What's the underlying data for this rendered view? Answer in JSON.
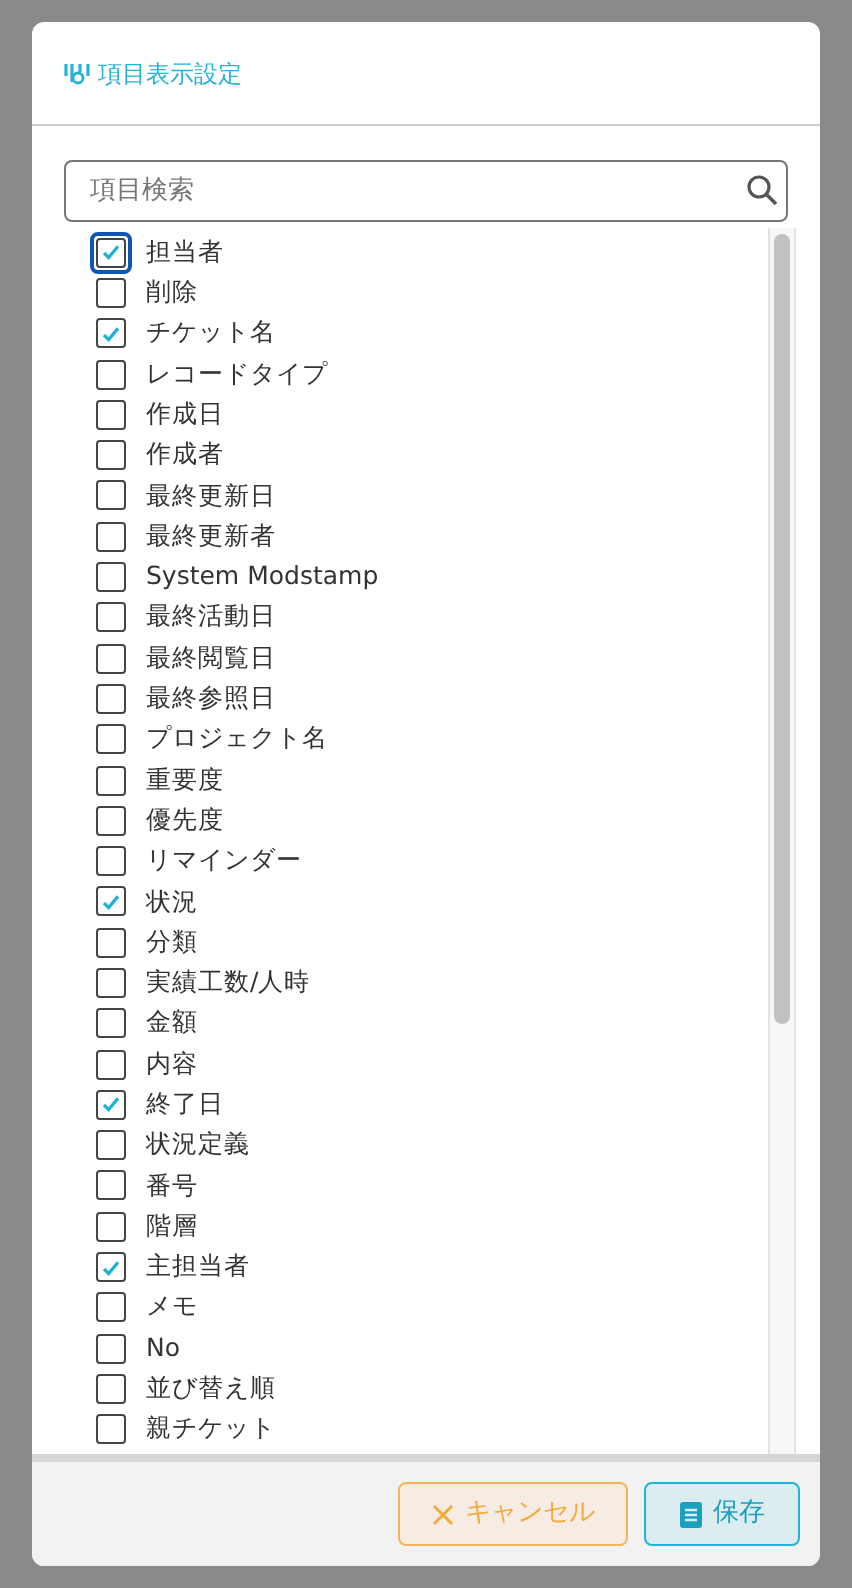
{
  "dialog": {
    "title": "項目表示設定"
  },
  "search": {
    "placeholder": "項目検索"
  },
  "fields": [
    {
      "label": "担当者",
      "checked": true,
      "focused": true
    },
    {
      "label": "削除",
      "checked": false,
      "focused": false
    },
    {
      "label": "チケット名",
      "checked": true,
      "focused": false
    },
    {
      "label": "レコードタイプ",
      "checked": false,
      "focused": false
    },
    {
      "label": "作成日",
      "checked": false,
      "focused": false
    },
    {
      "label": "作成者",
      "checked": false,
      "focused": false
    },
    {
      "label": "最終更新日",
      "checked": false,
      "focused": false
    },
    {
      "label": "最終更新者",
      "checked": false,
      "focused": false
    },
    {
      "label": "System Modstamp",
      "checked": false,
      "focused": false
    },
    {
      "label": "最終活動日",
      "checked": false,
      "focused": false
    },
    {
      "label": "最終閲覧日",
      "checked": false,
      "focused": false
    },
    {
      "label": "最終参照日",
      "checked": false,
      "focused": false
    },
    {
      "label": "プロジェクト名",
      "checked": false,
      "focused": false
    },
    {
      "label": "重要度",
      "checked": false,
      "focused": false
    },
    {
      "label": "優先度",
      "checked": false,
      "focused": false
    },
    {
      "label": "リマインダー",
      "checked": false,
      "focused": false
    },
    {
      "label": "状況",
      "checked": true,
      "focused": false
    },
    {
      "label": "分類",
      "checked": false,
      "focused": false
    },
    {
      "label": "実績工数/人時",
      "checked": false,
      "focused": false
    },
    {
      "label": "金額",
      "checked": false,
      "focused": false
    },
    {
      "label": "内容",
      "checked": false,
      "focused": false
    },
    {
      "label": "終了日",
      "checked": true,
      "focused": false
    },
    {
      "label": "状況定義",
      "checked": false,
      "focused": false
    },
    {
      "label": "番号",
      "checked": false,
      "focused": false
    },
    {
      "label": "階層",
      "checked": false,
      "focused": false
    },
    {
      "label": "主担当者",
      "checked": true,
      "focused": false
    },
    {
      "label": "メモ",
      "checked": false,
      "focused": false
    },
    {
      "label": "No",
      "checked": false,
      "focused": false
    },
    {
      "label": "並び替え順",
      "checked": false,
      "focused": false
    },
    {
      "label": "親チケット",
      "checked": false,
      "focused": false
    }
  ],
  "buttons": [
    {
      "label": "キャンセル",
      "kind": "cancel"
    },
    {
      "label": "保存",
      "kind": "save"
    }
  ]
}
